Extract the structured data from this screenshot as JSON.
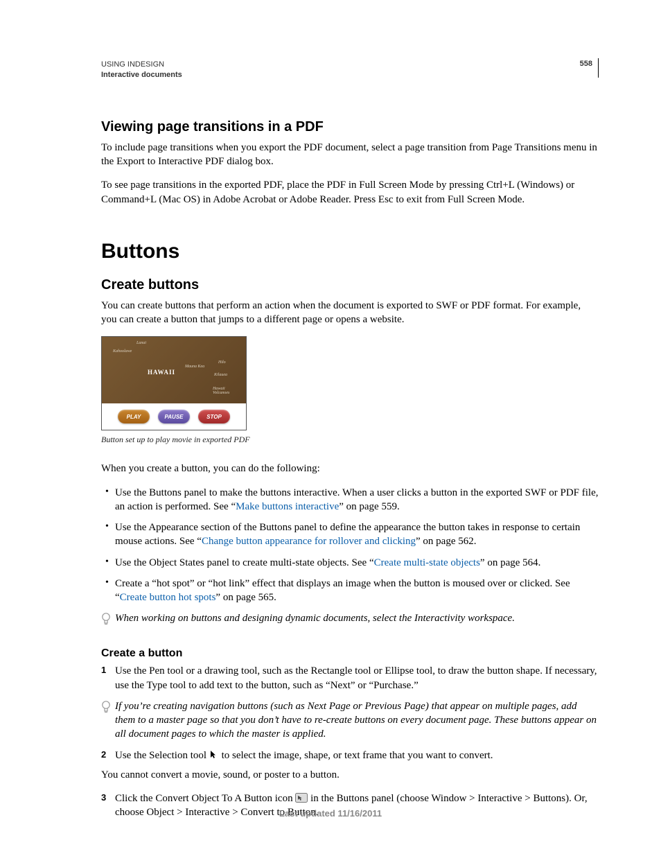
{
  "header": {
    "product": "USING INDESIGN",
    "section": "Interactive documents",
    "page_number": "558"
  },
  "sec1": {
    "title": "Viewing page transitions in a PDF",
    "p1": "To include page transitions when you export the PDF document, select a page transition from Page Transitions menu in the Export to Interactive PDF dialog box.",
    "p2": "To see page transitions in the exported PDF, place the PDF in Full Screen Mode by pressing Ctrl+L (Windows) or Command+L (Mac OS) in Adobe Acrobat or Adobe Reader. Press Esc to exit from Full Screen Mode."
  },
  "chapter": {
    "title": "Buttons"
  },
  "sec2": {
    "title": "Create buttons",
    "p1": "You can create buttons that perform an action when the document is exported to SWF or PDF format. For example, you can create a button that jumps to a different page or opens a website."
  },
  "figure": {
    "map_label": "HAWAII",
    "btn_play": "PLAY",
    "btn_pause": "PAUSE",
    "btn_stop": "STOP",
    "caption": "Button set up to play movie in exported PDF"
  },
  "p_when": "When you create a button, you can do the following:",
  "bullets": {
    "b1a": "Use the Buttons panel to make the buttons interactive. When a user clicks a button in the exported SWF or PDF file, an action is performed. See “",
    "b1link": "Make buttons interactive",
    "b1b": "” on page 559.",
    "b2a": "Use the Appearance section of the Buttons panel to define the appearance the button takes in response to certain mouse actions. See “",
    "b2link": "Change button appearance for rollover and clicking",
    "b2b": "” on page 562.",
    "b3a": "Use the Object States panel to create multi-state objects. See “",
    "b3link": "Create multi-state objects",
    "b3b": "” on page 564.",
    "b4a": "Create a “hot spot” or “hot link” effect that displays an image when the button is moused over or clicked. See “",
    "b4link": "Create button hot spots",
    "b4b": "” on page 565."
  },
  "tip1": "When working on buttons and designing dynamic documents, select the Interactivity workspace.",
  "sec3": {
    "title": "Create a button",
    "step1": "Use the Pen tool or a drawing tool, such as the Rectangle tool or Ellipse tool, to draw the button shape. If necessary, use the Type tool to add text to the button, such as “Next” or “Purchase.”",
    "tip2": "If you’re creating navigation buttons (such as Next Page or Previous Page) that appear on multiple pages, add them to a master page so that you don’t have to re-create buttons on every document page. These buttons appear on all document pages to which the master is applied.",
    "step2a": "Use the Selection tool ",
    "step2b": " to select the image, shape, or text frame that you want to convert.",
    "note": "You cannot convert a movie, sound, or poster to a button.",
    "step3a": "Click the Convert Object To A Button icon ",
    "step3b": " in the Buttons panel (choose Window > Interactive > Buttons). Or, choose Object > Interactive > Convert to Button."
  },
  "footer": {
    "updated": "Last updated 11/16/2011"
  }
}
